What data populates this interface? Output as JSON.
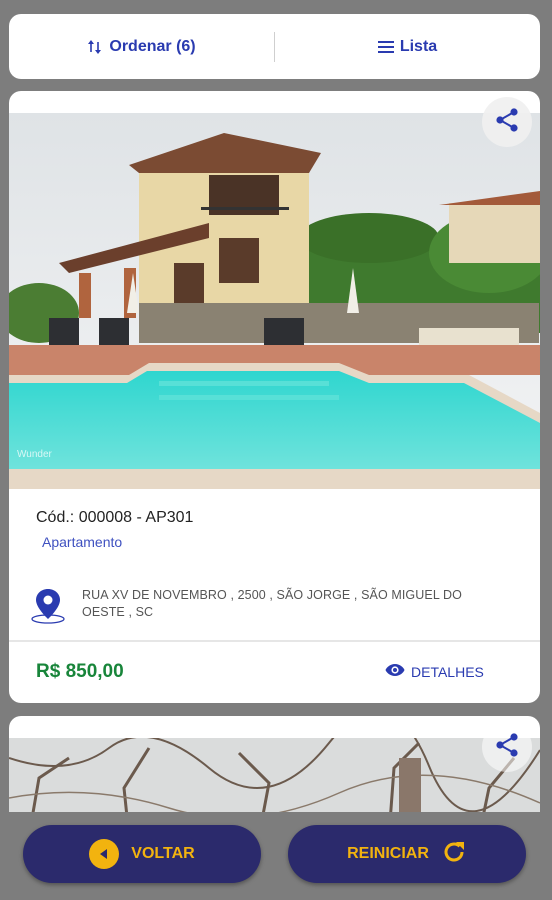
{
  "toolbar": {
    "sort_label": "Ordenar (6)",
    "list_label": "Lista"
  },
  "listing1": {
    "code": "Cód.: 000008 - AP301",
    "type": "Apartamento",
    "address": "RUA XV DE NOVEMBRO , 2500 , SÃO JORGE , SÃO MIGUEL DO OESTE , SC",
    "price": "R$  850,00",
    "details_label": "DETALHES",
    "watermark": "Wunder"
  },
  "actions": {
    "back_label": "VOLTAR",
    "restart_label": "REINICIAR"
  },
  "colors": {
    "accent_blue": "#2a3bb0",
    "price_green": "#18853a",
    "button_bg": "#2b2a6c",
    "button_text": "#f2b30f"
  },
  "icons": [
    "sort-icon",
    "list-icon",
    "share-icon",
    "location-pin-icon",
    "eye-icon",
    "back-arrow-icon",
    "refresh-icon"
  ]
}
